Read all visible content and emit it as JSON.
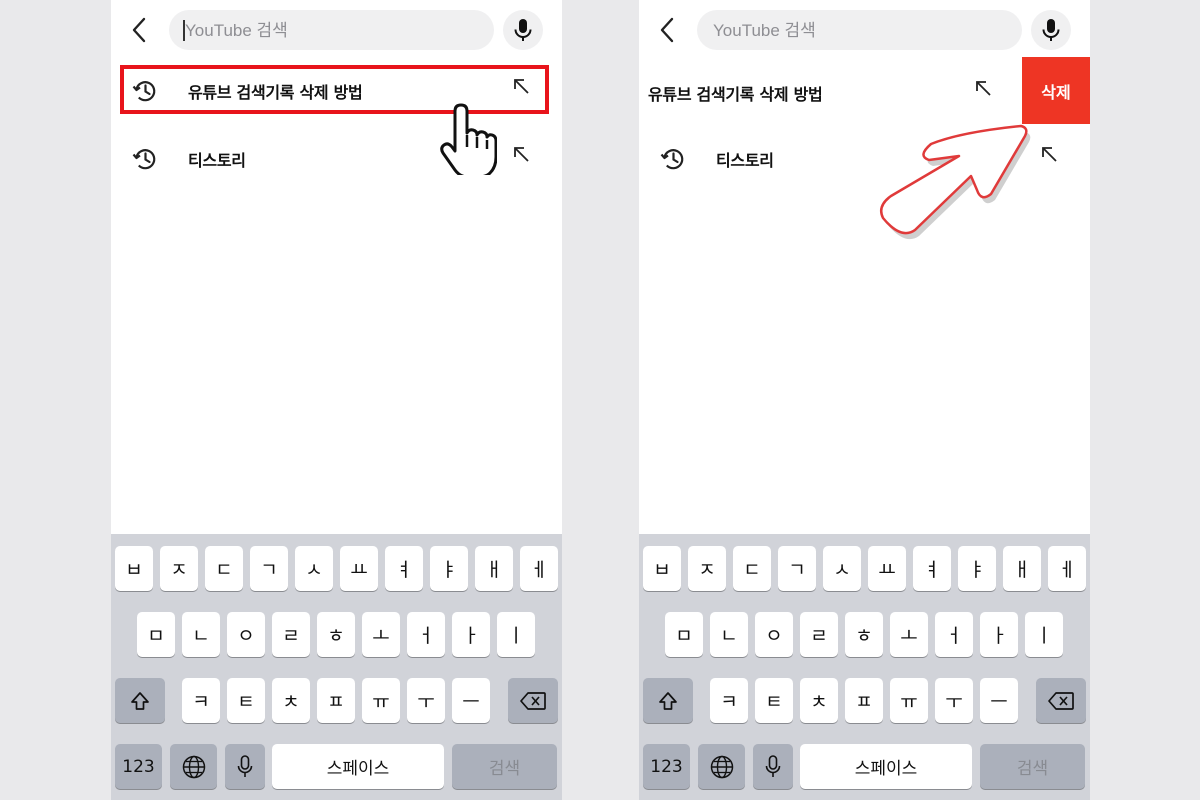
{
  "search": {
    "placeholder": "YouTube 검색"
  },
  "history": [
    {
      "label": "유튜브 검색기록 삭제 방법"
    },
    {
      "label": "티스토리"
    }
  ],
  "swipe_action": {
    "delete_label": "삭제"
  },
  "keyboard": {
    "row1": [
      "ㅂ",
      "ㅈ",
      "ㄷ",
      "ㄱ",
      "ㅅ",
      "ㅛ",
      "ㅕ",
      "ㅑ",
      "ㅐ",
      "ㅔ"
    ],
    "row2": [
      "ㅁ",
      "ㄴ",
      "ㅇ",
      "ㄹ",
      "ㅎ",
      "ㅗ",
      "ㅓ",
      "ㅏ",
      "ㅣ"
    ],
    "row3": [
      "ㅋ",
      "ㅌ",
      "ㅊ",
      "ㅍ",
      "ㅠ",
      "ㅜ",
      "ㅡ"
    ],
    "numbers_label": "123",
    "space_label": "스페이스",
    "search_label": "검색",
    "icons": {
      "shift": "shift-arrow-icon",
      "backspace": "backspace-icon",
      "globe": "globe-icon",
      "dictation": "microphone-icon"
    }
  },
  "colors": {
    "highlight": "#e8141b",
    "delete": "#ee3524",
    "keyboard_bg": "#d1d3d9",
    "key_dark": "#abb0bb"
  }
}
